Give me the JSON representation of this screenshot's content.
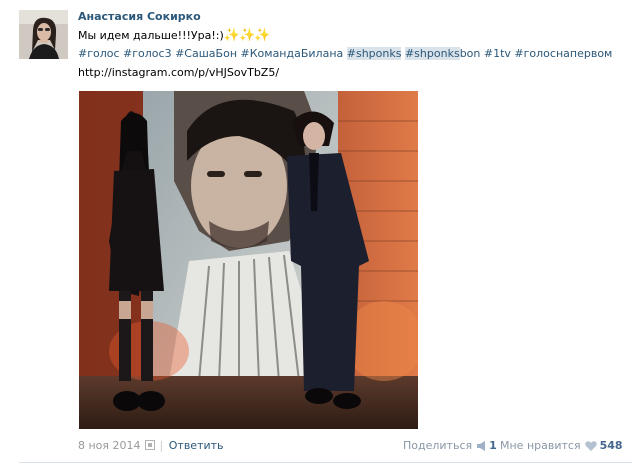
{
  "post": {
    "author": "Анастасия Сокирко",
    "text": "Мы идем дальше!!!Ура!:)",
    "sparkles_icon": "sparkles-emoji",
    "hashtags": [
      {
        "text": "#голос",
        "highlight": false
      },
      {
        "text": "#голос3",
        "highlight": false
      },
      {
        "text": "#СашаБон",
        "highlight": false
      },
      {
        "text": "#КомандаБилана",
        "highlight": false
      },
      {
        "text": "#shponks",
        "highlight": true
      },
      {
        "text": "#shponks",
        "highlight": true,
        "suffix": "bon"
      },
      {
        "text": "#1tv",
        "highlight": false
      },
      {
        "text": "#голоснапервом",
        "highlight": false
      }
    ],
    "link": "http://instagram.com/p/vHJSovTbZ5/"
  },
  "footer": {
    "date": "8 ноя 2014",
    "reply_label": "Ответить",
    "share_label": "Поделиться",
    "share_count": "1",
    "like_label": "Мне нравится",
    "like_count": "548"
  },
  "colors": {
    "link": "#2b587a",
    "muted": "#999999",
    "highlight": "#dae2ea"
  }
}
